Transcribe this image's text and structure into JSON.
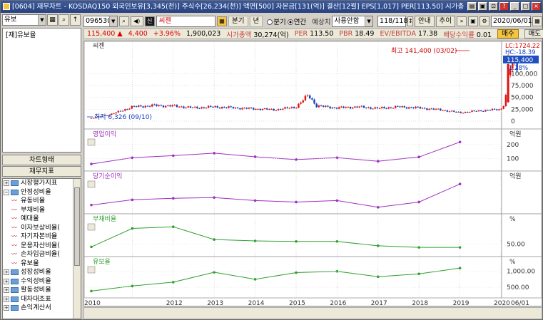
{
  "window": {
    "title": "[0604] 재무차트 - KOSDAQ150 외국인보유[3,345(천)] 주식수[26,234(천)] 액면[500] 자본금[131(억)] 결산[12월] EPS[1,017] PER[113.50] 시가총"
  },
  "left": {
    "category": "유보",
    "list_items": [
      "[재]유보율"
    ],
    "buttons": {
      "chart_type": "차트형태",
      "fin_index": "재무지표"
    },
    "tree": [
      {
        "label": "시장평가지표",
        "kind": "folder"
      },
      {
        "label": "안정성비율",
        "kind": "folder-open"
      },
      {
        "label": "유동비율",
        "kind": "leaf"
      },
      {
        "label": "부채비율",
        "kind": "leaf"
      },
      {
        "label": "예대율",
        "kind": "leaf"
      },
      {
        "label": "이자보상비율(",
        "kind": "leaf"
      },
      {
        "label": "자기자본비율",
        "kind": "leaf"
      },
      {
        "label": "운용자산비율(",
        "kind": "leaf"
      },
      {
        "label": "손차입금비율(",
        "kind": "leaf"
      },
      {
        "label": "유보율",
        "kind": "leaf"
      },
      {
        "label": "성장성비율",
        "kind": "folder"
      },
      {
        "label": "수익성비율",
        "kind": "folder"
      },
      {
        "label": "활동성비율",
        "kind": "folder"
      },
      {
        "label": "대차대조표",
        "kind": "folder"
      },
      {
        "label": "손익계산서",
        "kind": "folder"
      }
    ]
  },
  "toolbar": {
    "code": "096530",
    "sin": "신",
    "stock_name": "씨젠",
    "quarter_label": "분기",
    "year_label": "년",
    "radio_quarter": "분기",
    "radio_annual": "연간",
    "expect_label": "예상치",
    "no_use": "사용안함",
    "page": "118/118",
    "guide": "안내",
    "trend": "추이",
    "date": "2020/06/01"
  },
  "quote": {
    "price": "115,400",
    "arrow": "▲",
    "change": "4,400",
    "pct": "+3.96%",
    "volume": "1,900,023",
    "mcap_label": "시가총액",
    "mcap": "30,274(억)",
    "per_label": "PER",
    "per": "113.50",
    "pbr_label": "PBR",
    "pbr": "18.49",
    "ev_label": "EV/EBITDA",
    "ev": "17.38",
    "div_label": "배당수익률",
    "div": "0.01",
    "buy": "매수",
    "sell": "매도"
  },
  "colors": {
    "up": "#e01010",
    "down": "#1040c0",
    "line": "#a030c0",
    "green": "#30a030",
    "label_red": "#c04040"
  },
  "chart_data": [
    {
      "type": "line",
      "title": "씨젠",
      "annotations": [
        "최고 141,400 (03/02)",
        "최저 6,326 (09/10)"
      ],
      "right_labels": [
        "LC:1724.22",
        "HC:-18.39",
        "115,400",
        "-1.28%"
      ],
      "y_ticks": [
        "100,000",
        "75,000",
        "50,000",
        "25,000",
        "0"
      ],
      "ylim": [
        0,
        150000
      ],
      "x": [
        "2010",
        "2010.5",
        "2011",
        "2011.5",
        "2012",
        "2012.5",
        "2013",
        "2013.5",
        "2014",
        "2014.5",
        "2015",
        "2015.3",
        "2015.5",
        "2016",
        "2016.5",
        "2017",
        "2017.5",
        "2018",
        "2018.5",
        "2019",
        "2019.5",
        "2020",
        "2020.1",
        "2020.2",
        "2020.3",
        "2020.4"
      ],
      "values": [
        6326,
        15000,
        30000,
        33000,
        32000,
        28000,
        30000,
        28000,
        26000,
        24000,
        30000,
        55000,
        32000,
        28000,
        30000,
        27000,
        30000,
        28000,
        24000,
        18000,
        22000,
        25000,
        40000,
        110000,
        120000,
        115400
      ]
    },
    {
      "type": "line",
      "title": "영업이익",
      "unit": "억원",
      "y_ticks": [
        "200",
        "100"
      ],
      "x": [
        "2010",
        "2011",
        "2012",
        "2013",
        "2014",
        "2015",
        "2016",
        "2017",
        "2018",
        "2019"
      ],
      "values": [
        60,
        105,
        120,
        138,
        112,
        92,
        105,
        80,
        110,
        218
      ]
    },
    {
      "type": "line",
      "title": "당기순이익",
      "unit": "억원",
      "x": [
        "2010",
        "2011",
        "2012",
        "2013",
        "2014",
        "2015",
        "2016",
        "2017",
        "2018",
        "2019"
      ],
      "values": [
        50,
        85,
        95,
        100,
        80,
        70,
        80,
        35,
        70,
        190
      ]
    },
    {
      "type": "line",
      "title": "부채비율",
      "unit": "%",
      "y_ticks": [
        "50.00"
      ],
      "x": [
        "2010",
        "2011",
        "2012",
        "2013",
        "2014",
        "2015",
        "2016",
        "2017",
        "2018",
        "2019"
      ],
      "values": [
        40,
        108,
        114,
        67,
        62,
        60,
        60,
        44,
        38,
        38
      ]
    },
    {
      "type": "line",
      "title": "유보율",
      "unit": "%",
      "y_ticks": [
        "1,000.00",
        "500.00"
      ],
      "x": [
        "2010",
        "2011",
        "2012",
        "2013",
        "2014",
        "2015",
        "2016",
        "2017",
        "2018",
        "2019"
      ],
      "values": [
        380,
        540,
        660,
        970,
        750,
        960,
        1000,
        830,
        920,
        1100
      ]
    }
  ],
  "x_axis": [
    "2010",
    "2012",
    "2013",
    "2014",
    "2015",
    "2016",
    "2017",
    "2018",
    "2019",
    "2020",
    "06/01"
  ]
}
